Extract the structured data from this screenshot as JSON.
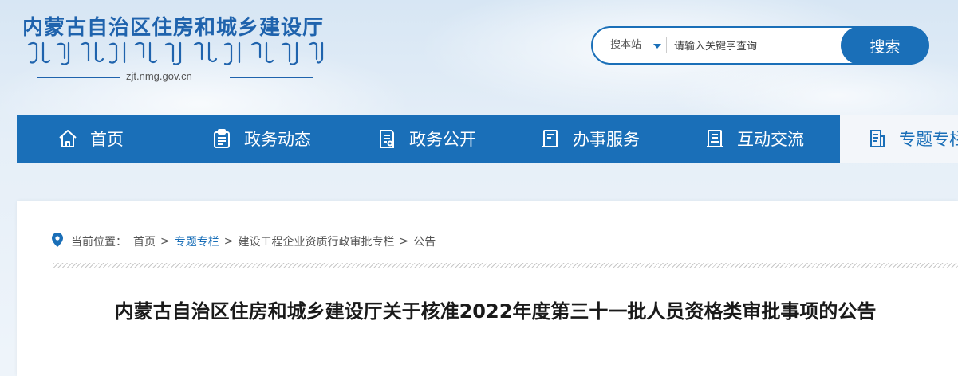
{
  "header": {
    "site_title": "内蒙古自治区住房和城乡建设厅",
    "domain": "zjt.nmg.gov.cn"
  },
  "search": {
    "scope_label": "搜本站",
    "placeholder": "请输入关键字查询",
    "button_label": "搜索"
  },
  "nav": {
    "items": [
      {
        "label": "首页",
        "icon": "home-icon"
      },
      {
        "label": "政务动态",
        "icon": "clipboard-icon"
      },
      {
        "label": "政务公开",
        "icon": "document-list-icon"
      },
      {
        "label": "办事服务",
        "icon": "form-icon"
      },
      {
        "label": "互动交流",
        "icon": "notepad-icon"
      },
      {
        "label": "专题专栏",
        "icon": "topic-icon"
      }
    ],
    "active_index": 5
  },
  "breadcrumb": {
    "prefix": "当前位置：",
    "items": [
      "首页",
      "专题专栏",
      "建设工程企业资质行政审批专栏",
      "公告"
    ],
    "separator": ">"
  },
  "article": {
    "title": "内蒙古自治区住房和城乡建设厅关于核准2022年度第三十一批人员资格类审批事项的公告"
  },
  "colors": {
    "brand_blue": "#1a6fb8",
    "title_blue": "#1f63ad"
  }
}
